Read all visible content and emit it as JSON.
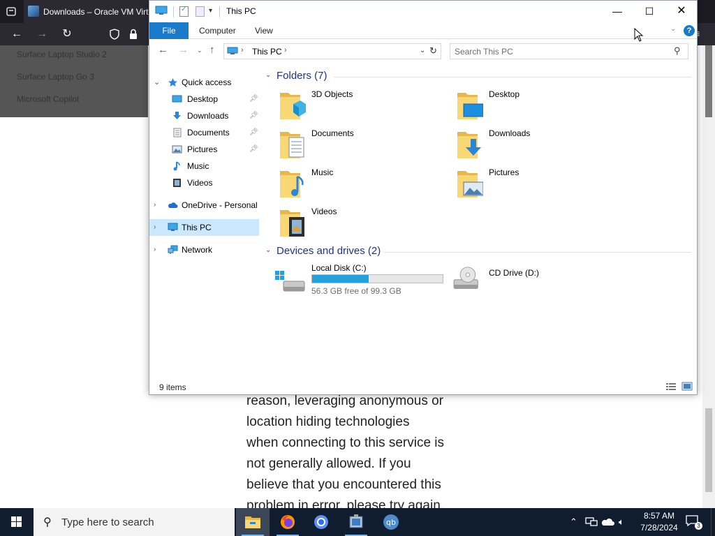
{
  "browser": {
    "tab_title": "Downloads – Oracle VM Virtu",
    "dropdown_items": [
      "Surface Laptop Studio 2",
      "Surface Laptop Go 3",
      "Microsoft Copilot"
    ],
    "page_lines": [
      "reason, leveraging anonymous or",
      "location hiding technologies",
      "when connecting to this service is",
      "not generally allowed. If you",
      "believe that you encountered this",
      "problem in error, please try again."
    ]
  },
  "explorer": {
    "title": "This PC",
    "ribbon_tabs": [
      "File",
      "Computer",
      "View"
    ],
    "help_label": "?",
    "address": "This PC",
    "search_placeholder": "Search This PC",
    "nav": {
      "quick_access": "Quick access",
      "quick_items": [
        {
          "label": "Desktop",
          "icon": "desktop-icon",
          "pinned": true
        },
        {
          "label": "Downloads",
          "icon": "downloads-icon",
          "pinned": true
        },
        {
          "label": "Documents",
          "icon": "documents-icon",
          "pinned": true
        },
        {
          "label": "Pictures",
          "icon": "pictures-icon",
          "pinned": true
        },
        {
          "label": "Music",
          "icon": "music-icon",
          "pinned": false
        },
        {
          "label": "Videos",
          "icon": "videos-icon",
          "pinned": false
        }
      ],
      "onedrive": "OneDrive - Personal",
      "this_pc": "This PC",
      "network": "Network"
    },
    "folders_header": "Folders (7)",
    "folders": [
      {
        "label": "3D Objects",
        "icon": "3d-objects-icon"
      },
      {
        "label": "Desktop",
        "icon": "desktop-folder-icon"
      },
      {
        "label": "Documents",
        "icon": "documents-folder-icon"
      },
      {
        "label": "Downloads",
        "icon": "downloads-folder-icon"
      },
      {
        "label": "Music",
        "icon": "music-folder-icon"
      },
      {
        "label": "Pictures",
        "icon": "pictures-folder-icon"
      },
      {
        "label": "Videos",
        "icon": "videos-folder-icon"
      }
    ],
    "drives_header": "Devices and drives (2)",
    "drives": [
      {
        "label": "Local Disk (C:)",
        "free_text": "56.3 GB free of 99.3 GB",
        "used_fraction": 0.433,
        "icon": "local-disk-icon"
      },
      {
        "label": "CD Drive (D:)",
        "icon": "cd-drive-icon"
      }
    ],
    "status": "9 items"
  },
  "taskbar": {
    "search_text": "Type here to search",
    "time": "8:57 AM",
    "date": "7/28/2024",
    "notification_count": "3",
    "apps": [
      "file-explorer-icon",
      "firefox-icon",
      "chromium-icon",
      "virtualbox-icon",
      "qbittorrent-icon"
    ]
  },
  "colors": {
    "accent": "#1979ca",
    "selection": "#cce8ff",
    "drive_fill": "#26a0da",
    "header_text": "#1e3287",
    "taskbar": "#101d2e"
  }
}
